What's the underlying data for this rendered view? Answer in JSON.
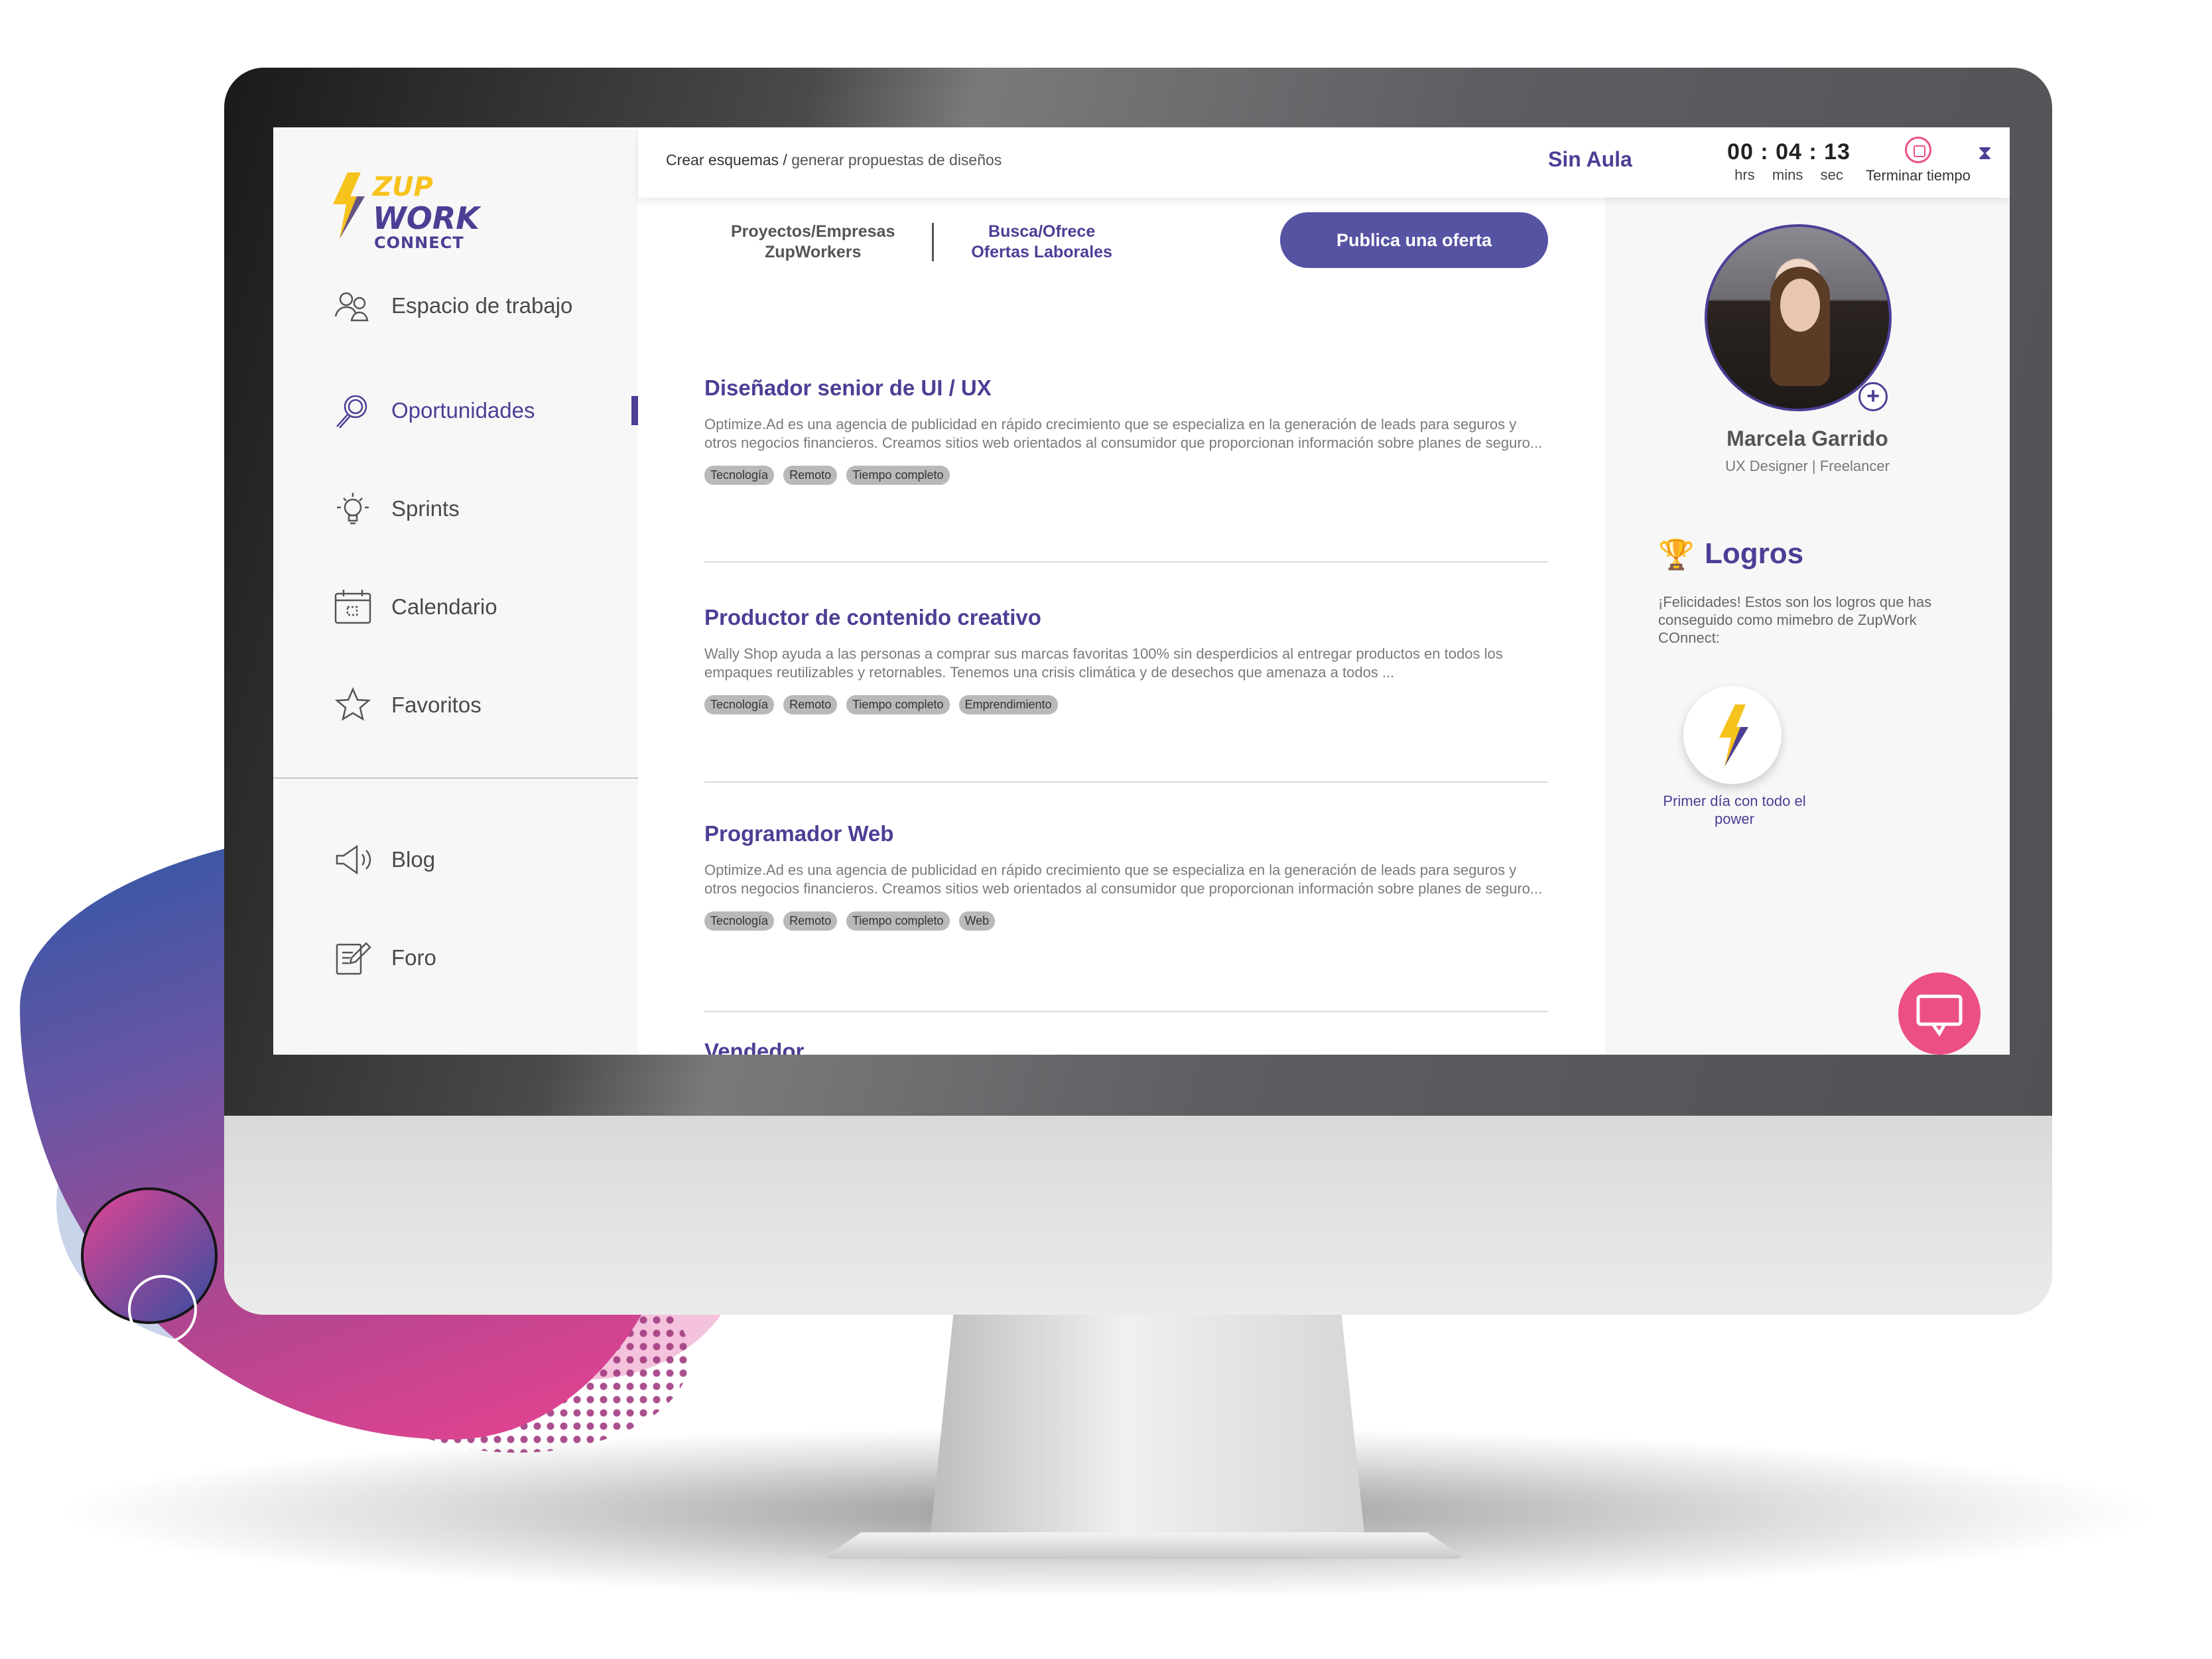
{
  "app": {
    "logo": {
      "line1": "ZUP",
      "line2": "WORK",
      "line3": "CONNECT"
    }
  },
  "sidebar": {
    "items": [
      {
        "label": "Espacio de trabajo",
        "icon": "users-icon"
      },
      {
        "label": "Oportunidades",
        "icon": "search-icon",
        "active": true
      },
      {
        "label": "Sprints",
        "icon": "lightbulb-icon"
      },
      {
        "label": "Calendario",
        "icon": "calendar-icon"
      },
      {
        "label": "Favoritos",
        "icon": "star-icon"
      }
    ],
    "secondary": [
      {
        "label": "Blog",
        "icon": "megaphone-icon"
      },
      {
        "label": "Foro",
        "icon": "edit-note-icon"
      }
    ]
  },
  "topbar": {
    "breadcrumb_main": "Crear esquemas /",
    "breadcrumb_sub": "generar propuestas de diseños",
    "aula": "Sin Aula",
    "timer": {
      "value": "00 : 04 : 13",
      "hrs": "hrs",
      "mins": "mins",
      "sec": "sec"
    },
    "stop_label": "Terminar tiempo"
  },
  "main": {
    "tabs": [
      {
        "line1": "Proyectos/Empresas",
        "line2": "ZupWorkers"
      },
      {
        "line1": "Busca/Ofrece",
        "line2": "Ofertas Laborales"
      }
    ],
    "publish_label": "Publica una oferta",
    "jobs": [
      {
        "title": "Diseñador senior de UI / UX",
        "description": "Optimize.Ad es una agencia de publicidad en rápido crecimiento que se especializa en la generación de leads para seguros y otros negocios financieros. Creamos sitios web orientados al consumidor que proporcionan información sobre planes de seguro...",
        "tags": [
          "Tecnología",
          "Remoto",
          "Tiempo completo"
        ]
      },
      {
        "title": "Productor de contenido creativo",
        "description": "Wally Shop ayuda a las personas a comprar sus marcas favoritas 100% sin desperdicios al entregar productos en todos los empaques reutilizables y retornables. Tenemos una crisis climática y de desechos que amenaza a todos ...",
        "tags": [
          "Tecnología",
          "Remoto",
          "Tiempo completo",
          "Emprendimiento"
        ]
      },
      {
        "title": "Programador Web",
        "description": "Optimize.Ad es una agencia de publicidad en rápido crecimiento que se especializa en la generación de leads para seguros y otros negocios financieros. Creamos sitios web orientados al consumidor que proporcionan información sobre planes de seguro...",
        "tags": [
          "Tecnología",
          "Remoto",
          "Tiempo completo",
          "Web"
        ]
      },
      {
        "title": "Vendedor",
        "description": "",
        "tags": []
      }
    ]
  },
  "profile": {
    "name": "Marcela Garrido",
    "role": "UX Designer | Freelancer",
    "achievements_title": "Logros",
    "achievements_desc": "¡Felicidades! Estos son los logros que has conseguido como mimebro de ZupWork COnnect:",
    "badge_label": "Primer día con todo el power"
  },
  "colors": {
    "brand": "#4b3f95",
    "accent_yellow": "#f6c21c",
    "button": "#5653a3",
    "pink": "#ec4f86"
  }
}
